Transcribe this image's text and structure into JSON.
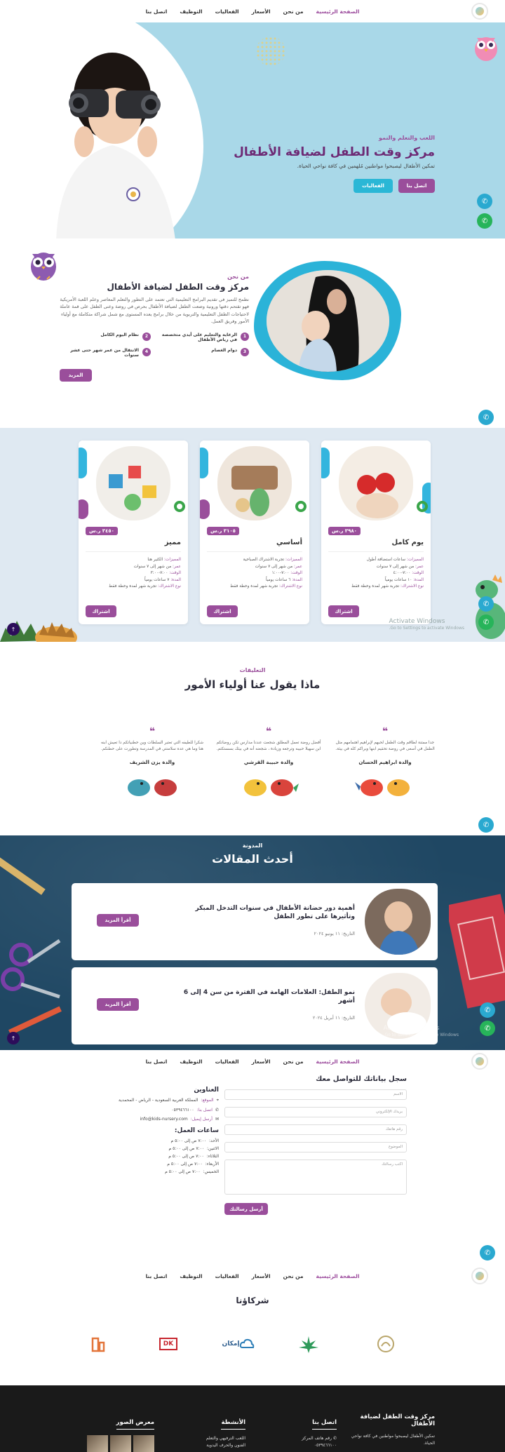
{
  "nav": {
    "items": [
      "الصفحة الرئيسية",
      "من نحن",
      "الأسعار",
      "الفعاليات",
      "التوظيف",
      "اتصل بنا"
    ]
  },
  "hero": {
    "eyebrow": "اللعب والتعلم والنمو",
    "title": "مركز وقت الطفل لضيافة الأطفال",
    "subtitle": "تمكين الأطفال ليصبحوا مواطنين مُلهمين في كافة نواحي الحياة.",
    "btn_contact": "اتصل بنا",
    "btn_events": "الفعاليات"
  },
  "about": {
    "eyebrow": "من نحن",
    "title": "مركز وقت الطفل لضيافة الأطفال",
    "body": "نطمح للتميز في تقديم البرامج التعليمية التي تعتمد على التطور والتعلم المعاصر وعلم اللعبة الأمريكية فهو تقتحم دقتها ورونية وضعت الطفل لضيافة الأطفال بحرص في روضة وعنى الطفل على قمة عاملة لاحتياجات الطفل التعليمية والتربوية من خلال برامج يعده المستوى مع شمل شراكة متكاملة مع أولياء الأمور وفريق العمل.",
    "features": [
      {
        "num": "1",
        "text": "الرعاية والتعليم على أيدي متخصصة في رياض الأطفال"
      },
      {
        "num": "2",
        "text": "نظام اليوم الكامل"
      },
      {
        "num": "3",
        "text": "دوام الغصام"
      },
      {
        "num": "4",
        "text": "الانتقال من عمر شهر حتى عشر سنوات"
      }
    ],
    "more": "المزيد"
  },
  "pricing": {
    "cards": [
      {
        "name": "يوم كامل",
        "price": "٣٩٨٠ ر.س",
        "rows": [
          {
            "k": "المميزات:",
            "v": "ساعات استضافة أطول"
          },
          {
            "k": "عمر:",
            "v": "من شهر إلى ٧ سنوات"
          },
          {
            "k": "الوقت:",
            "v": "٧:٠٠-٤:٠٠"
          },
          {
            "k": "المدة:",
            "v": "١٠ ساعات يومياً"
          },
          {
            "k": "نوع الاشتراك:",
            "v": "تجربة شهر لمدة وخطة فقط"
          }
        ],
        "subscribe": "اشتراك"
      },
      {
        "name": "أساسي",
        "price": "٣١٠٥ ر.س",
        "rows": [
          {
            "k": "المميزات:",
            "v": "تجربة الاشتراك الصباحية"
          },
          {
            "k": "عمر:",
            "v": "من شهر إلى ٧ سنوات"
          },
          {
            "k": "الوقت:",
            "v": "٧:٠٠-١:٠٠"
          },
          {
            "k": "المدة:",
            "v": "٦ ساعات يومياً"
          },
          {
            "k": "نوع الاشتراك:",
            "v": "تجربة شهر لمدة وخطة فقط"
          }
        ],
        "subscribe": "اشتراك"
      },
      {
        "name": "مميز",
        "price": "٣٤٥٠ ر.س",
        "rows": [
          {
            "k": "المميزات:",
            "v": "الكثير هنا"
          },
          {
            "k": "عمر:",
            "v": "من شهر إلى ٧ سنوات"
          },
          {
            "k": "الوقت:",
            "v": "٧:٠٠-٣:٠٠"
          },
          {
            "k": "المدة:",
            "v": "٧ ساعات يومياً"
          },
          {
            "k": "نوع الاشتراك:",
            "v": "تجربة شهر لمدة وخطة فقط"
          }
        ],
        "subscribe": "اشتراك"
      }
    ],
    "watermark": "Activate Windows",
    "watermark_sub": "Go to Settings to activate Windows."
  },
  "testimonials": {
    "eyebrow": "التعليقات",
    "title": "ماذا يقول عنا أولياء الأمور",
    "items": [
      {
        "text": "جدا ممتنة لطاقم وقت الطفل لحبهم لإبراهيم اهتمامهم مثل الطفل في أسعى في روضة تحقيم ابنها وبراكم كله في بيئة.",
        "who": "والدة ابراهيم الحسان"
      },
      {
        "text": "أفضل روضة تعمل المطلق شجعت عندنا مدارس تكن روضاتكم ابن سهيلا حبيبه وترجعه وزيادة ، شجعنه أنه في بيئك بسستكتم.",
        "who": "والدة حبيبة القرشي"
      },
      {
        "text": "شكرا للطيفه التي تعتبر السلطات وين حطنياتكم دا تعيش ابنه هنا وما هي عده سلامنتي في المدرسة وتطورت على حطنكم.",
        "who": "والدة يزن الشريف"
      }
    ]
  },
  "blog": {
    "eyebrow": "المدونة",
    "title": "أحدث المقالات",
    "posts": [
      {
        "title": "أهمية دور حضانة الأطفال في سنوات التدخل المبكر وتأثيرها على تطور الطفل",
        "date": "التاريخ: ١١ يونيو ٢٠٢٤",
        "more": "أقرأ المزيد"
      },
      {
        "title": "نمو الطفل: العلامات الهامة في الفترة من سن 4 إلى 6 أشهر",
        "date": "التاريخ: ١١ أبريل ٢٠٢٤",
        "more": "أقرأ المزيد"
      }
    ],
    "watermark": "Activate Windows",
    "watermark_sub": "Go to Settings to activate Windows."
  },
  "contact": {
    "title": "سجل بياناتك للتواصل معك",
    "fields": [
      "الاسم",
      "بريدك الإلكتروني",
      "رقم هاتفك",
      "الموضوع",
      "اكتب رسالتك"
    ],
    "send": "أرسل رسالتك",
    "addr_title": "العناوين",
    "address_k": "الموقع:",
    "address_v": "المملكة العربية السعودية - الرياض - المحمدية",
    "phone_k": "اتصل بنا:",
    "phone_v": "٠٥٣٩٤٦٦١٠٠",
    "email_k": "أرسل إيميل:",
    "email_v": "info@kids-nursery.com",
    "hours_title": "ساعات العمل:",
    "hours": [
      {
        "k": "الأحد:",
        "v": "٧:٠٠ ص إلى ٥:٠٠ م"
      },
      {
        "k": "الاثنين:",
        "v": "٧:٠٠ ص إلى ٥:٠٠ م"
      },
      {
        "k": "الثلاثاء:",
        "v": "٧:٠٠ ص إلى ٥:٠٠ م"
      },
      {
        "k": "الأربعاء:",
        "v": "٧:٠٠ ص إلى ٥:٠٠ م"
      },
      {
        "k": "الخميس:",
        "v": "٧:٠٠ ص إلى ٥:٠٠ م"
      }
    ]
  },
  "partners": {
    "title": "شركاؤنا",
    "logos": [
      "DK",
      "إمكان"
    ]
  },
  "footer": {
    "brand_title": "مركز وقت الطفل لضيافة الأطفال",
    "brand_text": "تمكين الأطفال ليصبحوا مواطنين في كافة نواحي الحياة.",
    "contact_title": "اتصل بنا",
    "contact_line1": "رقم هاتف المركز",
    "contact_line2": "٠٥٣٩٤٦٦١٠٠",
    "activities_title": "الأنشطة",
    "activities": [
      "اللعب الترفيهي والتعلم",
      "الفنون والحرف اليدوية"
    ],
    "gallery_title": "معرض الصور"
  },
  "colors": {
    "brand": "#9a4e9b",
    "teal": "#2ab7d6",
    "hero_bg": "#a9d8e8",
    "pricing_bg": "#dfe9f2",
    "blog_bg": "#1f4763"
  }
}
